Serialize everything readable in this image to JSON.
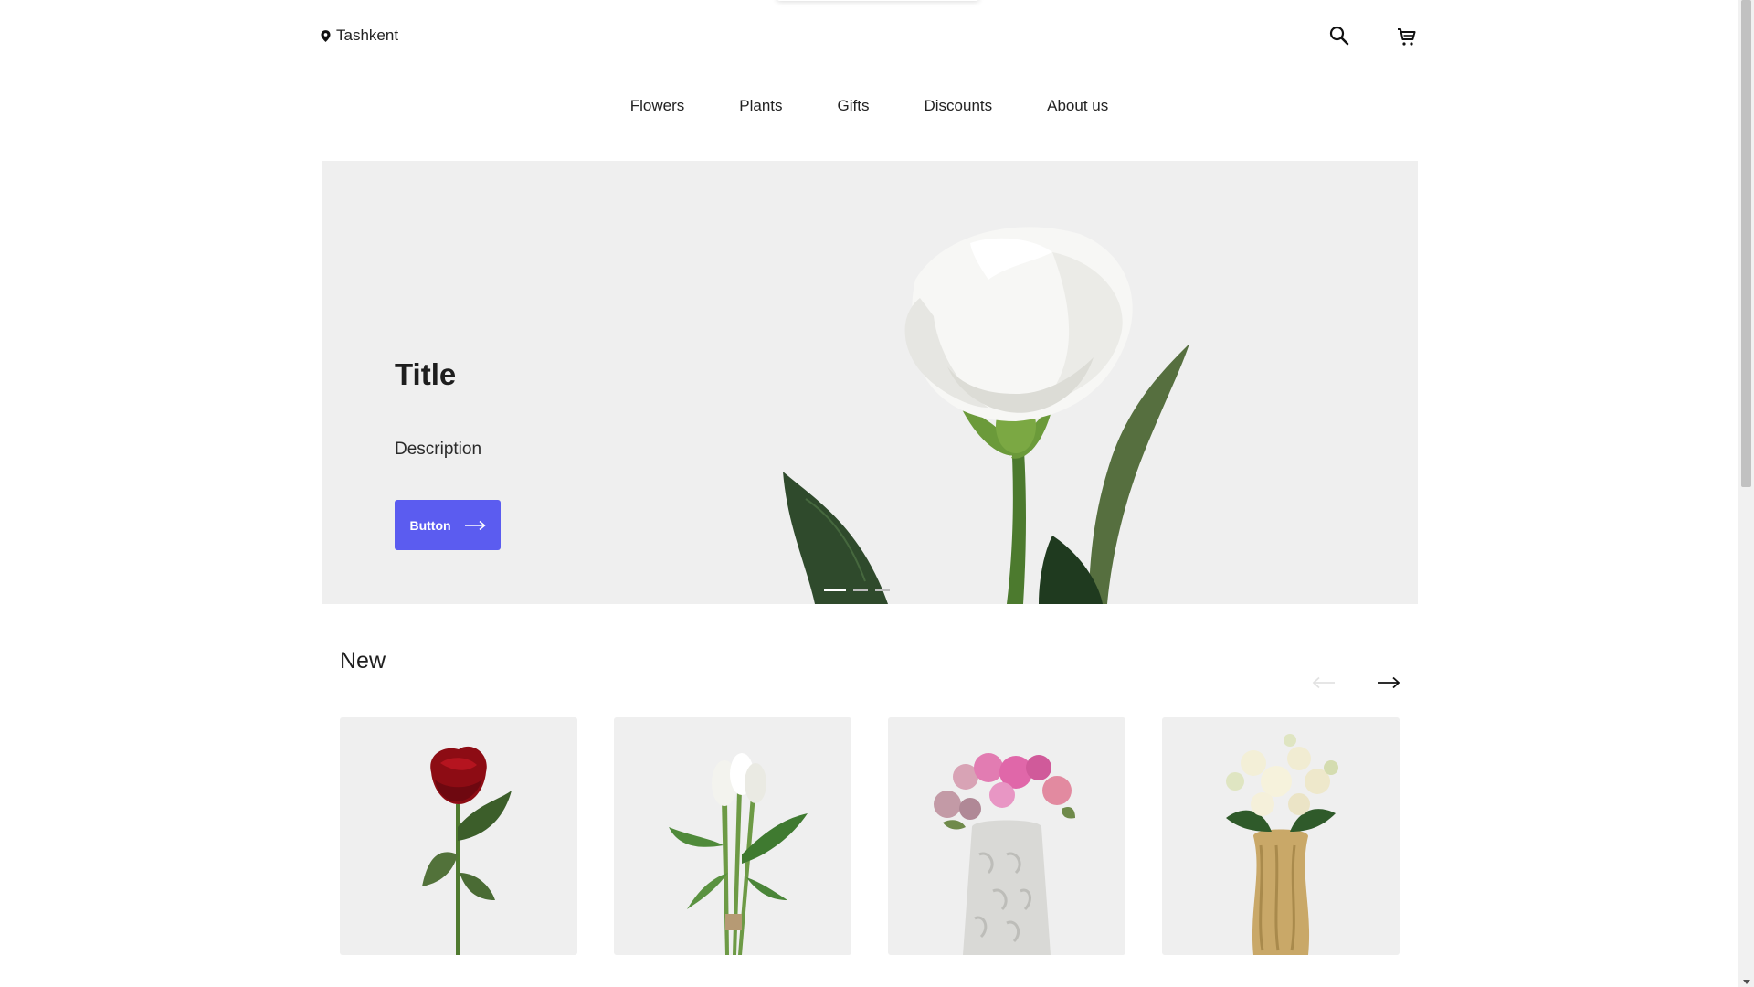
{
  "header": {
    "location_icon": "map-pin-icon",
    "location": "Tashkent",
    "search_icon": "search-icon",
    "cart_icon": "cart-icon"
  },
  "nav": {
    "items": [
      {
        "label": "Flowers"
      },
      {
        "label": "Plants"
      },
      {
        "label": "Gifts"
      },
      {
        "label": "Discounts"
      },
      {
        "label": "About us"
      }
    ]
  },
  "hero": {
    "title": "Title",
    "description": "Description",
    "button_label": "Button",
    "button_color": "#5b5cf0",
    "slides_total": 3,
    "active_slide": 1
  },
  "new_section": {
    "title": "New",
    "products": [
      {
        "name": "red-rose",
        "icon": "red-rose-image"
      },
      {
        "name": "white-tulips",
        "icon": "white-tulips-image"
      },
      {
        "name": "pink-bouquet-vase",
        "icon": "pink-bouquet-image"
      },
      {
        "name": "cream-bouquet-gold-vase",
        "icon": "cream-bouquet-image"
      }
    ]
  }
}
